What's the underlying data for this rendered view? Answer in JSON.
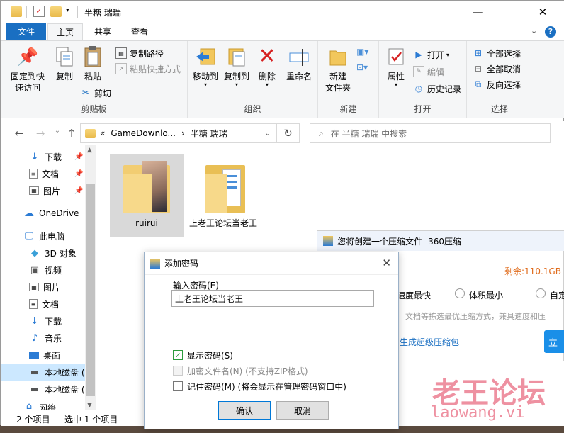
{
  "explorer": {
    "title": "半糖 瑞瑞",
    "tabs": [
      {
        "label": "文件"
      },
      {
        "label": "主页"
      },
      {
        "label": "共享"
      },
      {
        "label": "查看"
      }
    ],
    "ribbon": {
      "clipboard": {
        "group_label": "剪贴板",
        "pin_label_1": "固定到快",
        "pin_label_2": "速访问",
        "copy_label": "复制",
        "paste_label": "粘贴",
        "copy_path_label": "复制路径",
        "paste_shortcut_label": "粘贴快捷方式",
        "cut_label": "剪切"
      },
      "organize": {
        "group_label": "组织",
        "move_to_label": "移动到",
        "copy_to_label": "复制到",
        "delete_label": "删除",
        "rename_label": "重命名"
      },
      "new": {
        "group_label": "新建",
        "new_folder_label_1": "新建",
        "new_folder_label_2": "文件夹"
      },
      "open": {
        "group_label": "打开",
        "properties_label": "属性",
        "open_label": "打开",
        "edit_label": "编辑",
        "history_label": "历史记录"
      },
      "select": {
        "group_label": "选择",
        "select_all_label": "全部选择",
        "select_none_label": "全部取消",
        "invert_label": "反向选择"
      }
    },
    "address": {
      "chevron": "«",
      "crumb_1": "GameDownlo...",
      "separator": "›",
      "crumb_2": "半糖 瑞瑞"
    },
    "search_placeholder": "在 半糖 瑞瑞 中搜索",
    "nav": {
      "downloads_pinned": "下载",
      "documents_pinned": "文档",
      "pictures_pinned": "图片",
      "onedrive": "OneDrive",
      "this_pc": "此电脑",
      "objects_3d": "3D 对象",
      "videos": "视频",
      "pictures": "图片",
      "documents": "文档",
      "downloads": "下载",
      "music": "音乐",
      "desktop": "桌面",
      "local_disk_1": "本地磁盘 (",
      "local_disk_2": "本地磁盘 (",
      "network": "网络"
    },
    "files": [
      {
        "name": "ruirui"
      },
      {
        "name": "上老王论坛当老王"
      }
    ],
    "status": {
      "count": "2 个项目",
      "selected": "选中 1 个项目"
    }
  },
  "zip360": {
    "title": "您将创建一个压缩文件 -360压缩",
    "remaining": "剩余:110.1GB",
    "opt_fastest": "速度最快",
    "opt_smallest": "体积最小",
    "opt_custom": "自定",
    "hint": "文档等拣选最优压缩方式，兼具速度和压",
    "super_pack": "生成超级压缩包",
    "start_btn": "立"
  },
  "password_dialog": {
    "title": "添加密码",
    "input_label": "输入密码(E)",
    "input_value": "上老王论坛当老王",
    "show_password": "显示密码(S)",
    "encrypt_names": "加密文件名(N) (不支持ZIP格式)",
    "remember_password": "记住密码(M) (将会显示在管理密码窗口中)",
    "ok": "确认",
    "cancel": "取消"
  },
  "watermark": {
    "line1": "老王论坛",
    "line2": "laowang.vi"
  },
  "colors": {
    "accent": "#1a6fc2",
    "selection": "#cce8ff",
    "remaining": "#e06b1b",
    "link": "#1a6fc2",
    "watermark": "#e8637a"
  }
}
